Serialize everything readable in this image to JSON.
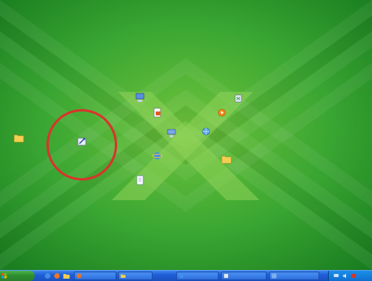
{
  "desktop": {
    "wallpaper_colors": {
      "light": "#74c83e",
      "mid": "#3aa632",
      "dark": "#167a1e",
      "x_mark": "#8fd35a"
    },
    "highlight_color": "#d8342c",
    "icons": [
      {
        "label": "",
        "icon": "folder-icon"
      },
      {
        "label": "",
        "icon": "tools-icon"
      },
      {
        "label": "",
        "icon": "computer-icon"
      },
      {
        "label": "",
        "icon": "documents-icon"
      },
      {
        "label": "",
        "icon": "network-icon"
      },
      {
        "label": "",
        "icon": "internet-explorer-icon"
      },
      {
        "label": "",
        "icon": "document-icon"
      },
      {
        "label": "",
        "icon": "recycle-bin-icon"
      },
      {
        "label": "",
        "icon": "media-player-icon"
      },
      {
        "label": "",
        "icon": "network-places-icon"
      },
      {
        "label": "",
        "icon": "folder-icon"
      }
    ]
  },
  "taskbar": {
    "start_label": "",
    "tasks": [
      {
        "label": "",
        "icon": "firefox-icon"
      },
      {
        "label": "",
        "icon": "folder-icon"
      },
      {
        "label": "",
        "icon": "internet-explorer-icon"
      },
      {
        "label": "",
        "icon": "window-icon"
      },
      {
        "label": "",
        "icon": "program-icon"
      }
    ],
    "tray_icons": [
      "network-tray-icon",
      "volume-tray-icon",
      "security-tray-icon"
    ]
  }
}
